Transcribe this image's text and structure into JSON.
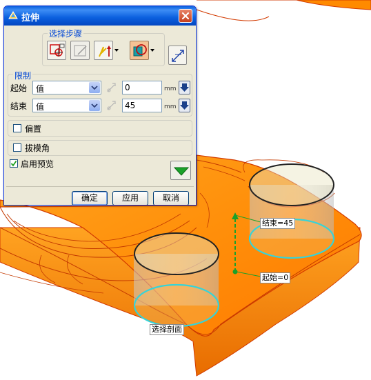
{
  "dialog": {
    "title": "拉伸",
    "steps_group_label": "选择步骤",
    "limits_group_label": "限制",
    "start": {
      "label": "起始",
      "type": "值",
      "value": "0",
      "unit": "mm"
    },
    "end": {
      "label": "结束",
      "type": "值",
      "value": "45",
      "unit": "mm"
    },
    "offset_label": "偏置",
    "draft_label": "拔模角",
    "preview_label": "启用预览",
    "preview_checked": true,
    "buttons": {
      "ok": "确定",
      "apply": "应用",
      "cancel": "取消"
    }
  },
  "viewport": {
    "end_handle_label": "结束=45",
    "start_handle_label": "起始=0",
    "section_label": "选择剖面"
  },
  "colors": {
    "part": "#ff8a00",
    "part_edge": "#d23a00",
    "section_circle": "#36d3d8",
    "handle": "#1aa12a",
    "titlebar": "#0a5fde"
  }
}
